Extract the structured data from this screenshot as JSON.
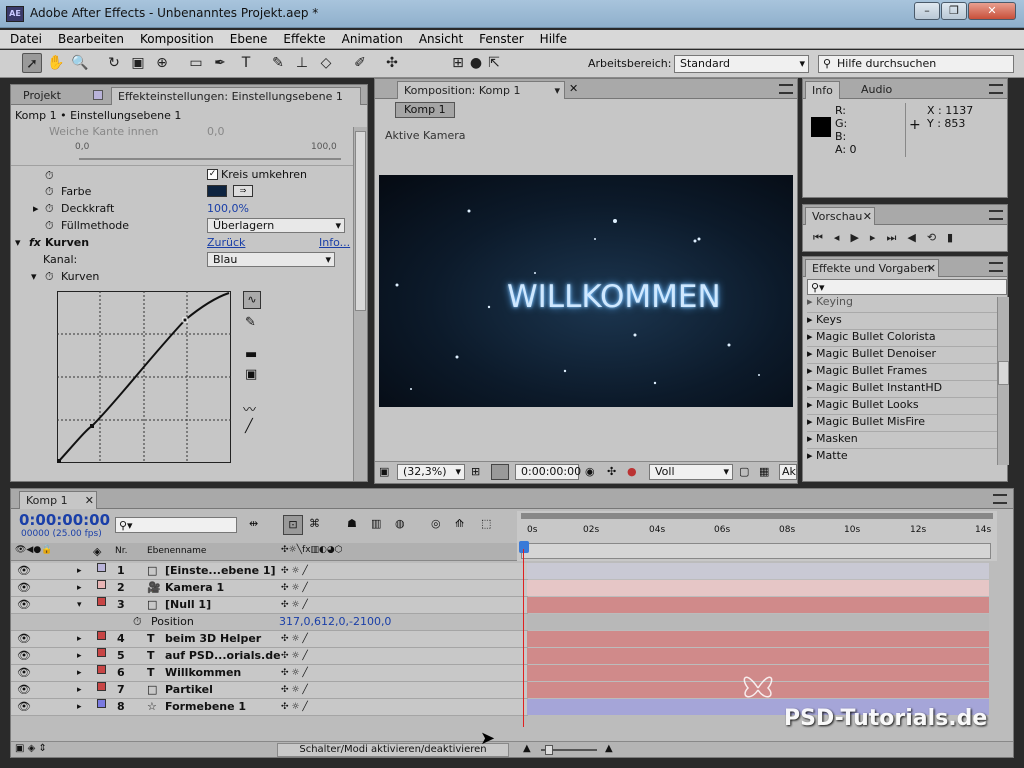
{
  "window": {
    "title": "Adobe After Effects - Unbenanntes Projekt.aep *",
    "icon": "AE"
  },
  "menu": [
    "Datei",
    "Bearbeiten",
    "Komposition",
    "Ebene",
    "Effekte",
    "Animation",
    "Ansicht",
    "Fenster",
    "Hilfe"
  ],
  "toolbar": {
    "workspace_label": "Arbeitsbereich:",
    "workspace_value": "Standard",
    "help_placeholder": "Hilfe durchsuchen"
  },
  "left_panel": {
    "tab_project": "Projekt",
    "tab_effects": "Effekteinstellungen: Einstellungsebene 1",
    "breadcrumb": "Komp 1 • Einstellungsebene 1",
    "faded_row": "Weiche Kante innen",
    "faded_val": "0,0",
    "slider_min": "0,0",
    "slider_max": "100,0",
    "invert_label": "Kreis umkehren",
    "color_label": "Farbe",
    "opacity_label": "Deckkraft",
    "opacity_value": "100,0%",
    "blend_label": "Füllmethode",
    "blend_value": "Überlagern",
    "curves_label": "Kurven",
    "reset": "Zurück",
    "info": "Info...",
    "channel_label": "Kanal:",
    "channel_value": "Blau",
    "curves_sub": "Kurven"
  },
  "comp_panel": {
    "tab": "Komposition: Komp 1",
    "comp_button": "Komp 1",
    "camera": "Aktive Kamera",
    "text": "WILLKOMMEN",
    "zoom": "(32,3%)",
    "time": "0:00:00:00",
    "quality": "Voll",
    "view": "Ak"
  },
  "info_panel": {
    "tab_info": "Info",
    "tab_audio": "Audio",
    "r": "R:",
    "g": "G:",
    "b": "B:",
    "a": "A:  0",
    "x": "X : 1137",
    "y": "Y : 853"
  },
  "preview_panel": {
    "tab": "Vorschau"
  },
  "effects_panel": {
    "tab": "Effekte und Vorgaben",
    "search_icon": "search-icon",
    "items": [
      "Keying",
      "Keys",
      "Magic Bullet Colorista",
      "Magic Bullet Denoiser",
      "Magic Bullet Frames",
      "Magic Bullet InstantHD",
      "Magic Bullet Looks",
      "Magic Bullet MisFire",
      "Masken",
      "Matte"
    ]
  },
  "timeline": {
    "tab": "Komp 1",
    "timecode": "0:00:00:00",
    "fps": "00000 (25.00 fps)",
    "col_nr": "Nr.",
    "col_name": "Ebenenname",
    "ruler": [
      "0s",
      "02s",
      "04s",
      "06s",
      "08s",
      "10s",
      "12s",
      "14s"
    ],
    "layers": [
      {
        "nr": "1",
        "name": "[Einste...ebene 1]",
        "color": "#b9b3d9",
        "icon": "solid",
        "bar": "#c9c9d4"
      },
      {
        "nr": "2",
        "name": "Kamera 1",
        "color": "#e8b5b5",
        "icon": "camera",
        "bar": "#e6c6c6"
      },
      {
        "nr": "3",
        "name": "[Null 1]",
        "color": "#c84545",
        "icon": "solid",
        "bar": "#d08a8a"
      },
      {
        "nr": "4",
        "name": "beim 3D Helper",
        "color": "#c84545",
        "icon": "T",
        "bar": "#d08a8a"
      },
      {
        "nr": "5",
        "name": "auf PSD...orials.de",
        "color": "#c84545",
        "icon": "T",
        "bar": "#d08a8a"
      },
      {
        "nr": "6",
        "name": "Willkommen",
        "color": "#c84545",
        "icon": "T",
        "bar": "#d08a8a"
      },
      {
        "nr": "7",
        "name": "Partikel",
        "color": "#c84545",
        "icon": "solid",
        "bar": "#d08a8a"
      },
      {
        "nr": "8",
        "name": "Formebene 1",
        "color": "#7a7ae0",
        "icon": "star",
        "bar": "#a5a5d8"
      }
    ],
    "position_label": "Position",
    "position_value": "317,0,612,0,-2100,0",
    "switch_modes": "Schalter/Modi aktivieren/deaktivieren"
  },
  "watermark": "PSD-Tutorials.de"
}
